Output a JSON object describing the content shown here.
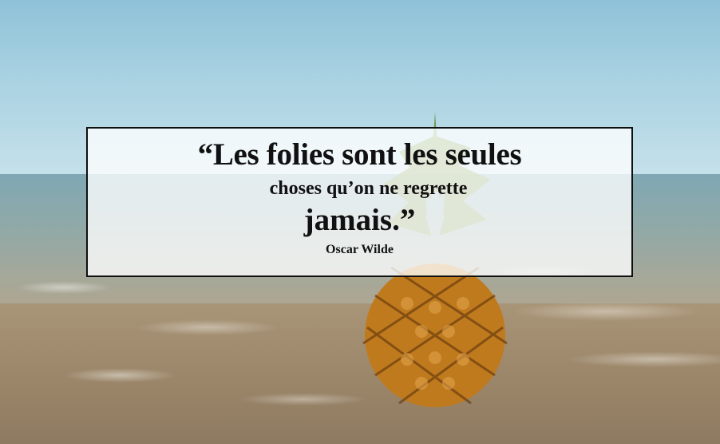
{
  "quote": {
    "line1": "“Les folies sont les seules",
    "line2": "choses qu’on ne regrette",
    "line3": "jamais.”",
    "author": "Oscar Wilde"
  },
  "colors": {
    "sky": "#a9d2e2",
    "sea": "#8fa9a8",
    "sand": "#9c876a",
    "pineapple_body": "#c07a1e",
    "pineapple_leaves": "#6e8f3a",
    "box_border": "#0f0f0f"
  }
}
